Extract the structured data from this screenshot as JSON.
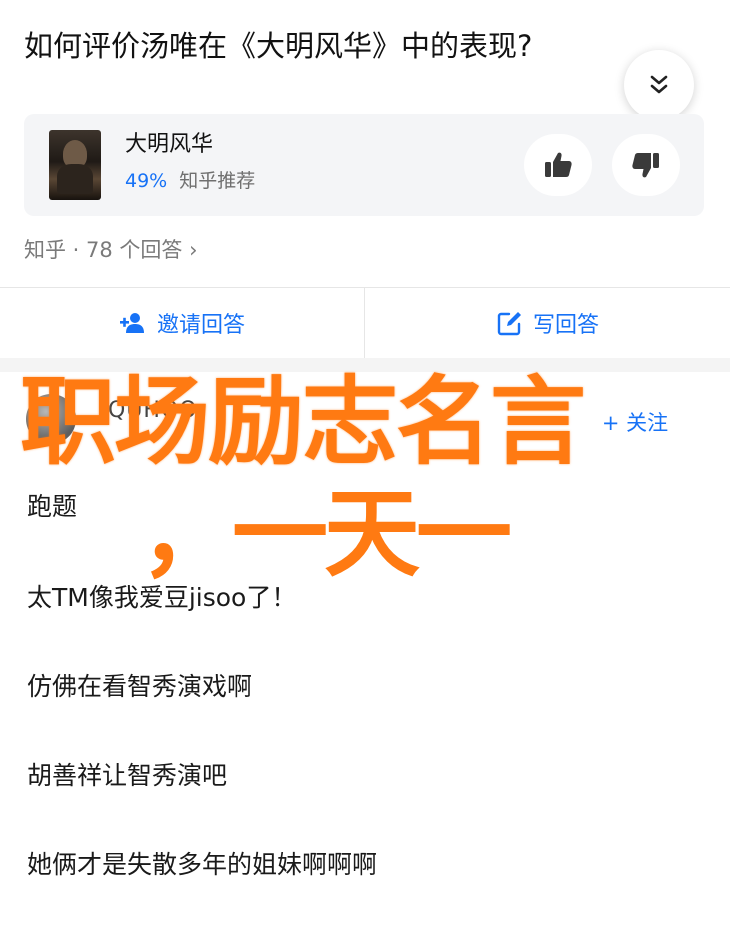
{
  "question": {
    "title": "如何评价汤唯在《大明风华》中的表现?"
  },
  "drama_card": {
    "name": "大明风华",
    "recommend_percent": "49%",
    "recommend_label": "知乎推荐"
  },
  "meta": {
    "source_and_count": "知乎 · 78 个回答 ›"
  },
  "actions": {
    "invite_label": "邀请回答",
    "write_label": "写回答"
  },
  "answer_author": {
    "name": "QUHOO",
    "follow_label": "+ 关注"
  },
  "overlay": {
    "line1": "职场励志名言",
    "line2": "，一天一"
  },
  "answer_lines": [
    "跑题",
    "太TM像我爱豆jisoo了！",
    "仿佛在看智秀演戏啊",
    "胡善祥让智秀演吧",
    "她俩才是失散多年的姐妹啊啊啊"
  ],
  "colors": {
    "accent": "#1772f6",
    "overlay": "#ff7a12",
    "card_bg": "#f4f5f7"
  }
}
